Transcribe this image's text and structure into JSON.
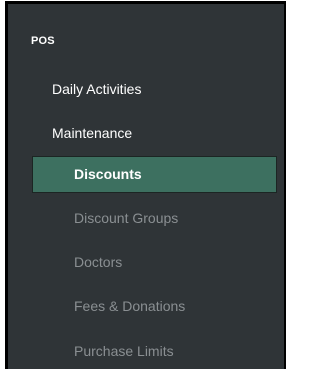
{
  "sidebar": {
    "section_label": "POS",
    "groups": [
      {
        "label": "Daily Activities"
      },
      {
        "label": "Maintenance"
      }
    ],
    "items": [
      {
        "label": "Discounts",
        "active": true
      },
      {
        "label": "Discount Groups",
        "active": false
      },
      {
        "label": "Doctors",
        "active": false
      },
      {
        "label": "Fees & Donations",
        "active": false
      },
      {
        "label": "Purchase Limits",
        "active": false
      }
    ]
  },
  "colors": {
    "background": "#2f3437",
    "active_item": "#3d7060",
    "text_primary": "#ffffff",
    "text_muted": "#8a8f92"
  }
}
